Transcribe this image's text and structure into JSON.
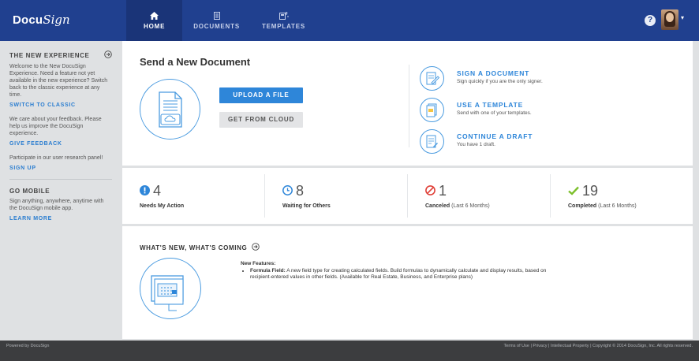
{
  "header": {
    "logo_part1": "Docu",
    "logo_part2": "Sign",
    "tabs": [
      {
        "label": "HOME",
        "icon": "home-icon",
        "active": true
      },
      {
        "label": "DOCUMENTS",
        "icon": "documents-icon",
        "active": false
      },
      {
        "label": "TEMPLATES",
        "icon": "templates-icon",
        "active": false
      }
    ],
    "help_glyph": "?",
    "avatar_caret": "▾"
  },
  "sidebar": {
    "new_experience": {
      "heading": "THE NEW EXPERIENCE",
      "text": "Welcome to the New DocuSign Experience. Need a feature not yet available in the new experience? Switch back to the classic experience at any time.",
      "link": "SWITCH TO CLASSIC"
    },
    "feedback": {
      "text": "We care about your feedback. Please help us improve the DocuSign experience.",
      "link": "GIVE FEEDBACK"
    },
    "research": {
      "text": "Participate in our user research panel!",
      "link": "SIGN UP"
    },
    "mobile": {
      "heading": "GO MOBILE",
      "text": "Sign anything, anywhere, anytime with the DocuSign mobile app.",
      "link": "LEARN MORE"
    }
  },
  "send": {
    "title": "Send a New Document",
    "upload_label": "UPLOAD A FILE",
    "cloud_label": "GET FROM CLOUD",
    "actions": [
      {
        "title": "SIGN A DOCUMENT",
        "subtitle": "Sign quickly if you are the only signer.",
        "icon": "sign-document-icon"
      },
      {
        "title": "USE A TEMPLATE",
        "subtitle": "Send with one of your templates.",
        "icon": "template-icon"
      },
      {
        "title": "CONTINUE A DRAFT",
        "subtitle": "You have 1 draft.",
        "icon": "draft-icon"
      }
    ]
  },
  "stats": [
    {
      "value": "4",
      "label": "Needs My Action",
      "label_suffix": "",
      "icon": "alert-icon",
      "color": "#2e86d9"
    },
    {
      "value": "8",
      "label": "Waiting for Others",
      "label_suffix": "",
      "icon": "clock-icon",
      "color": "#2e86d9"
    },
    {
      "value": "1",
      "label": "Canceled",
      "label_suffix": "(Last 6 Months)",
      "icon": "canceled-icon",
      "color": "#e0423a"
    },
    {
      "value": "19",
      "label": "Completed",
      "label_suffix": "(Last 6 Months)",
      "icon": "check-icon",
      "color": "#7cbf2b"
    }
  ],
  "whats_new": {
    "title": "WHAT'S NEW, WHAT'S COMING",
    "features_heading": "New Features:",
    "feature_name": "Formula Field:",
    "feature_text": "A new field type for creating calculated fields. Build formulas to dynamically calculate and display results, based on recipient-entered values in other fields. (Available for Real Estate, Business, and Enterprise plans)"
  },
  "footer": {
    "powered_by": "Powered by DocuSign",
    "links": "Terms of Use  |  Privacy  |  Intellectual Property  |  Copyright © 2014 DocuSign, Inc. All rights reserved."
  },
  "colors": {
    "header": "#20408f",
    "accent": "#2e86d9",
    "canceled": "#e0423a",
    "completed": "#7cbf2b"
  }
}
